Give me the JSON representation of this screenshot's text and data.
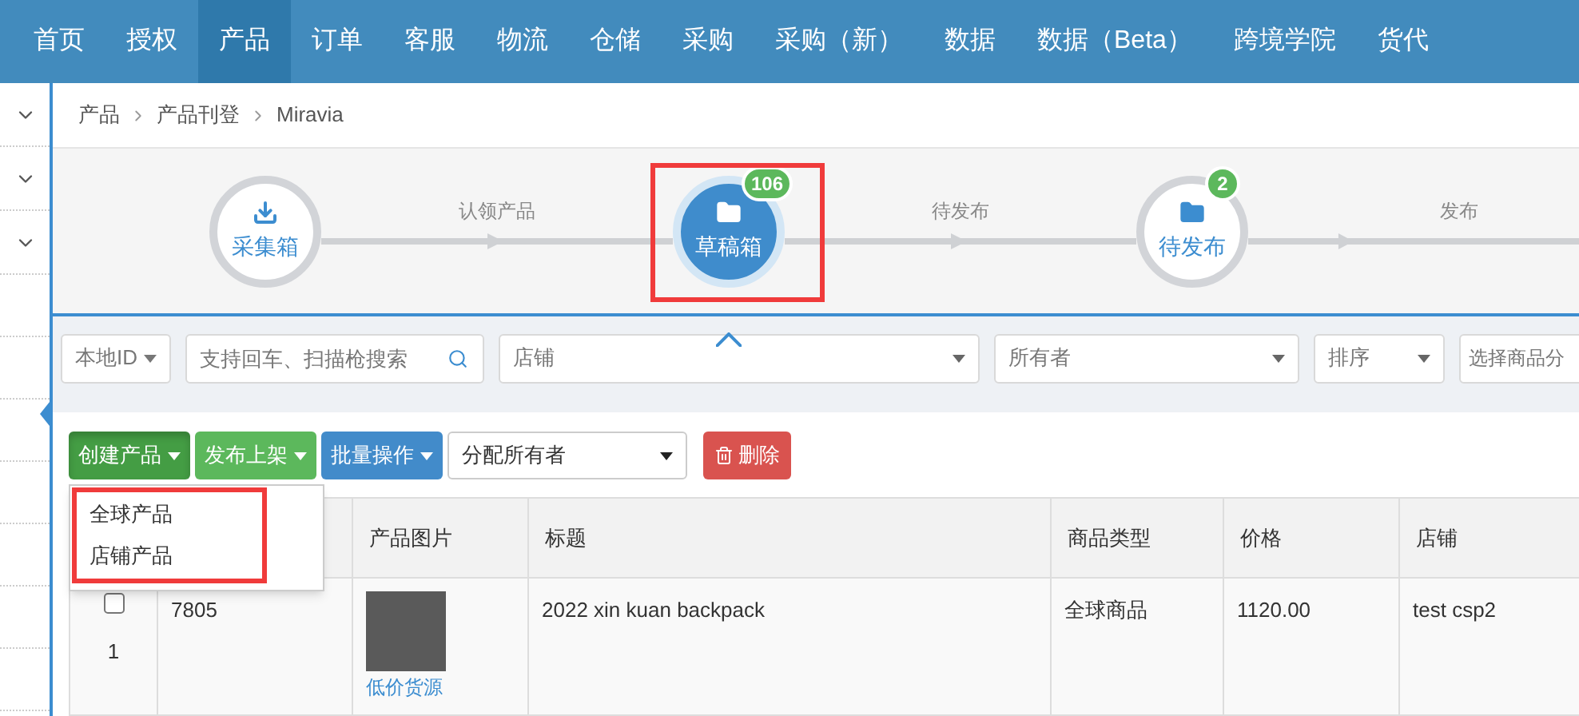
{
  "nav": [
    {
      "label": "首页",
      "selected": false
    },
    {
      "label": "授权",
      "selected": false
    },
    {
      "label": "产品",
      "selected": true
    },
    {
      "label": "订单",
      "selected": false
    },
    {
      "label": "客服",
      "selected": false
    },
    {
      "label": "物流",
      "selected": false
    },
    {
      "label": "仓储",
      "selected": false
    },
    {
      "label": "采购",
      "selected": false
    },
    {
      "label": "采购（新）",
      "selected": false
    },
    {
      "label": "数据",
      "selected": false
    },
    {
      "label": "数据（Beta）",
      "selected": false
    },
    {
      "label": "跨境学院",
      "selected": false
    },
    {
      "label": "货代",
      "selected": false
    }
  ],
  "breadcrumb": [
    "产品",
    "产品刊登",
    "Miravia"
  ],
  "workflow": {
    "steps": [
      {
        "label": "采集箱",
        "kind": "collect",
        "selected": false
      },
      {
        "label": "草稿箱",
        "kind": "folder",
        "selected": true,
        "badge": "106"
      },
      {
        "label": "待发布",
        "kind": "folder",
        "selected": false,
        "badge": "2"
      }
    ],
    "connectors": [
      "认领产品",
      "待发布",
      "发布"
    ]
  },
  "filters": [
    {
      "kind": "dropdown",
      "label": "本地ID"
    },
    {
      "kind": "search",
      "placeholder": "支持回车、扫描枪搜索"
    },
    {
      "kind": "select",
      "placeholder": "店铺"
    },
    {
      "kind": "select",
      "placeholder": "所有者"
    },
    {
      "kind": "select",
      "placeholder": "排序"
    },
    {
      "kind": "plain",
      "placeholder": "选择商品分"
    }
  ],
  "toolbar": {
    "buttons": [
      {
        "label": "创建产品",
        "color": "#449d44",
        "expanded": true
      },
      {
        "label": "发布上架",
        "color": "#5cb85c",
        "expanded": false
      },
      {
        "label": "批量操作",
        "color": "#428bca",
        "expanded": false
      }
    ],
    "owner_select": "分配所有者",
    "delete": "删除"
  },
  "menu": {
    "items": [
      "全球产品",
      "店铺产品"
    ]
  },
  "table": {
    "columns": [
      "产品图片",
      "标题",
      "商品类型",
      "价格",
      "店铺"
    ],
    "rows": [
      {
        "checked": false,
        "index": "1",
        "id": "7805",
        "image_link": "低价货源",
        "title": "2022 xin kuan backpack",
        "type": "全球商品",
        "price": "1120.00",
        "store": "test csp2"
      }
    ]
  }
}
